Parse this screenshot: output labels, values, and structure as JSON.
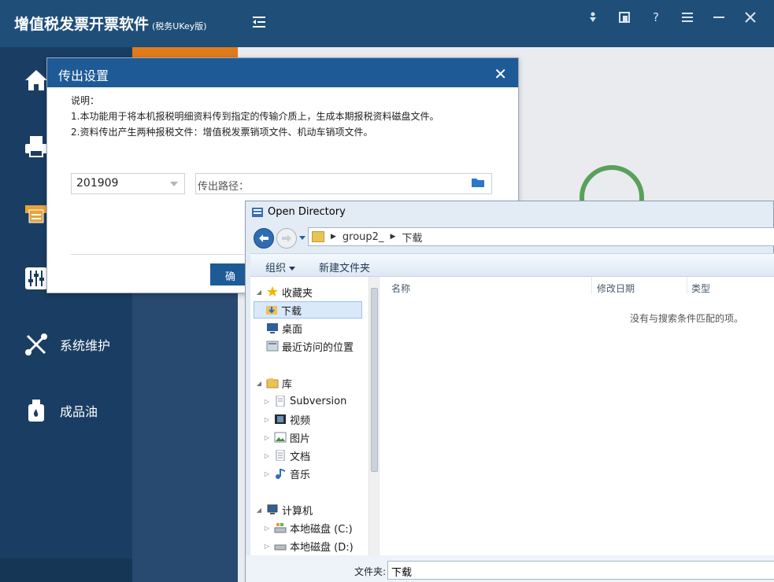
{
  "app": {
    "title": "增值税发票开票软件",
    "subtitle": "(税务UKey版)"
  },
  "window_controls": [
    "download-icon",
    "window-icon",
    "help-icon",
    "menu-icon",
    "minimize-icon",
    "close-icon"
  ],
  "sidebar": {
    "items": [
      {
        "label": "",
        "icon": "home-icon"
      },
      {
        "label": "",
        "icon": "printer-icon"
      },
      {
        "label": "",
        "icon": "invoice-icon"
      },
      {
        "label": "",
        "icon": "sliders-icon"
      },
      {
        "label": "系统维护",
        "icon": "tools-icon"
      },
      {
        "label": "成品油",
        "icon": "oil-can-icon"
      }
    ]
  },
  "export_dialog": {
    "title": "传出设置",
    "desc_heading": "说明：",
    "desc_line1": "1.本功能用于将本机报税明细资料传到指定的传输介质上，生成本期报税资料磁盘文件。",
    "desc_line2": "2.资料传出产生两种报税文件：增值税发票销项文件、机动车销项文件。",
    "period": "201909",
    "path_placeholder": "传出路径：",
    "ok_label": "确"
  },
  "open_directory": {
    "title": "Open Directory",
    "address": [
      "group2_",
      "下载"
    ],
    "toolbar": {
      "organize": "组织",
      "new_folder": "新建文件夹"
    },
    "nav": {
      "favorites": "收藏夹",
      "downloads": "下载",
      "desktop": "桌面",
      "recent": "最近访问的位置",
      "libraries": "库",
      "subversion": "Subversion",
      "videos": "视频",
      "pictures": "图片",
      "documents": "文档",
      "music": "音乐",
      "computer": "计算机",
      "drive_c": "本地磁盘 (C:)",
      "drive_d": "本地磁盘 (D:)"
    },
    "columns": {
      "name": "名称",
      "modified": "修改日期",
      "type": "类型"
    },
    "empty_message": "没有与搜索条件匹配的项。",
    "folder_label": "文件夹:",
    "folder_value": "下载"
  },
  "colors": {
    "header": "#1f4e79",
    "sidebar": "#1a3d63",
    "dialog_title": "#1e5a96",
    "accent_orange": "#e07b1a"
  }
}
